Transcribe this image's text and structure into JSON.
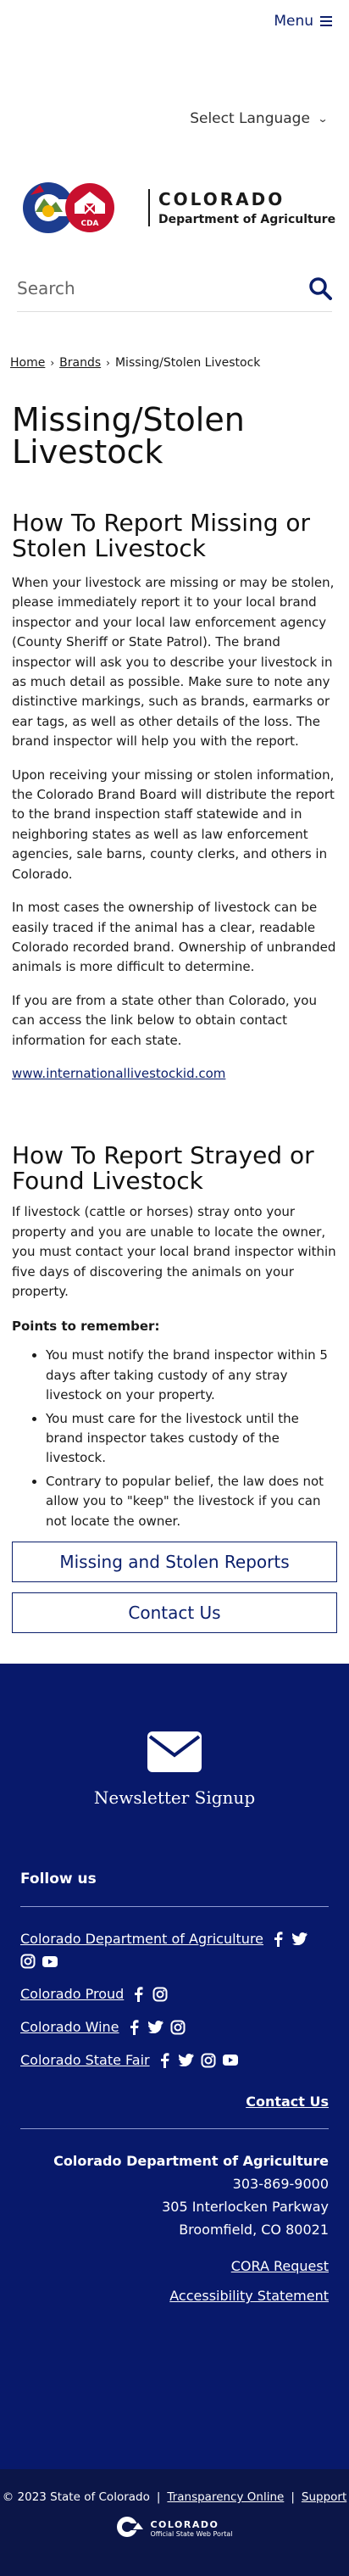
{
  "header": {
    "menu_label": "Menu",
    "language_label": "Select Language",
    "logo": {
      "line1": "COLORADO",
      "line2": "Department of Agriculture",
      "badge": "CDA"
    },
    "search_placeholder": "Search"
  },
  "breadcrumb": [
    {
      "label": "Home"
    },
    {
      "label": "Brands"
    },
    {
      "label": "Missing/Stolen Livestock"
    }
  ],
  "page_title": "Missing/Stolen Livestock",
  "section1": {
    "heading": "How To Report Missing or Stolen Livestock",
    "paragraphs": [
      "When your livestock are missing or may be stolen, please immediately report it to your local brand inspector and your local law enforcement agency (County Sheriff or State Patrol). The brand inspector will ask you to describe your livestock in as much detail as possible. Make sure to note any distinctive markings, such as brands, earmarks or ear tags, as well as other details of the loss. The brand inspector will help you with the report.",
      "Upon receiving your missing or stolen information, the Colorado Brand Board will distribute the report to the brand inspection staff statewide and in neighboring states as well as law enforcement agencies, sale barns, county clerks, and others in Colorado.",
      "In most cases the ownership of livestock can be easily traced if the animal has a clear, readable Colorado recorded brand. Ownership of unbranded animals is more difficult to determine.",
      "If you are from a state other than Colorado, you can access the link below to obtain contact information for each state."
    ],
    "link": "www.internationallivestockid.com"
  },
  "section2": {
    "heading": "How To Report Strayed or Found Livestock",
    "paragraph": "If livestock (cattle or horses) stray onto your property and you are unable to locate the owner, you must contact your local brand inspector within five days of discovering the animals on your property.",
    "points_heading": "Points to remember:",
    "points": [
      "You must notify the brand inspector within 5 days after taking custody of any stray livestock on your property.",
      "You must care for the livestock until the brand inspector takes custody of the livestock.",
      "Contrary to popular belief, the law does not allow you to \"keep\" the livestock if you can not locate the owner."
    ]
  },
  "buttons": {
    "reports": "Missing and Stolen Reports",
    "contact": "Contact Us"
  },
  "footer": {
    "newsletter": "Newsletter Signup",
    "follow_heading": "Follow us",
    "social": [
      {
        "name": "Colorado Department of Agriculture",
        "icons": [
          "facebook-icon",
          "twitter-icon",
          "instagram-icon",
          "youtube-icon"
        ]
      },
      {
        "name": "Colorado Proud",
        "icons": [
          "facebook-icon",
          "instagram-icon"
        ]
      },
      {
        "name": "Colorado Wine",
        "icons": [
          "facebook-icon",
          "twitter-icon",
          "instagram-icon"
        ]
      },
      {
        "name": "Colorado State Fair",
        "icons": [
          "facebook-icon",
          "twitter-icon",
          "instagram-icon",
          "youtube-icon"
        ]
      }
    ],
    "contact_link": "Contact Us",
    "org": "Colorado Department of Agriculture",
    "phone": "303-869-9000",
    "street": "305 Interlocken Parkway",
    "city": "Broomfield, CO 80021",
    "cora": "CORA Request",
    "accessibility": "Accessibility Statement",
    "copyright": "© 2023 State of Colorado",
    "transparency": "Transparency Online",
    "support": "Support",
    "portal_line1": "COLORADO",
    "portal_line2": "Official State Web Portal"
  },
  "colors": {
    "brand_navy": "#08196b",
    "sub_footer": "#0c1648",
    "logo_blue": "#1d3d8f",
    "logo_red": "#c8102e",
    "logo_gold": "#f2b705",
    "logo_green": "#5c8a3a"
  }
}
